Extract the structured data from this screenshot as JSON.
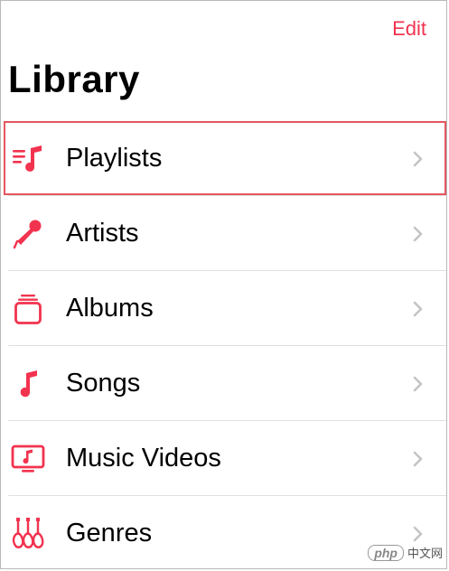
{
  "header": {
    "edit_label": "Edit",
    "title": "Library"
  },
  "library": {
    "items": [
      {
        "label": "Playlists",
        "icon": "playlists-icon"
      },
      {
        "label": "Artists",
        "icon": "microphone-icon"
      },
      {
        "label": "Albums",
        "icon": "albums-icon"
      },
      {
        "label": "Songs",
        "icon": "music-note-icon"
      },
      {
        "label": "Music Videos",
        "icon": "music-video-icon"
      },
      {
        "label": "Genres",
        "icon": "guitars-icon"
      }
    ],
    "highlighted_item": "Playlists"
  },
  "watermark": {
    "brand": "php",
    "site": "中文网"
  },
  "colors": {
    "accent": "#f2334f",
    "highlight_border": "#e4575f",
    "chevron": "#c4c4c7",
    "divider": "#e0e0e0"
  }
}
